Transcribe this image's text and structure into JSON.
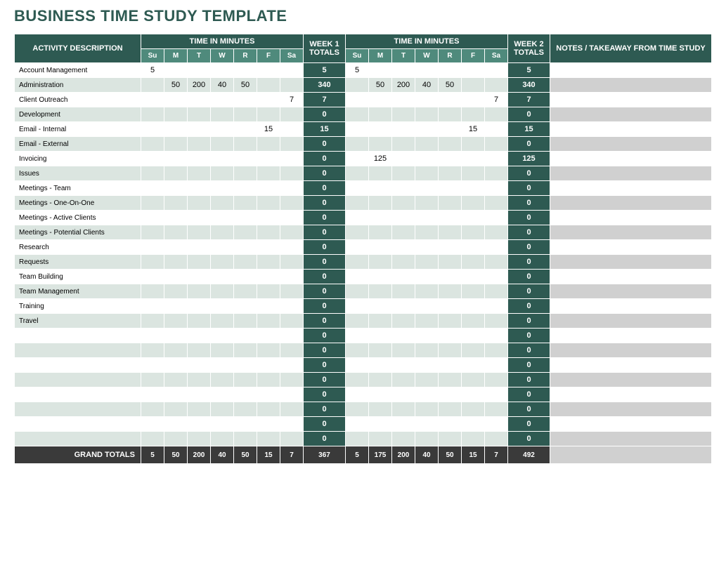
{
  "title": "BUSINESS TIME STUDY TEMPLATE",
  "headers": {
    "activity": "ACTIVITY DESCRIPTION",
    "time_in_minutes": "TIME IN MINUTES",
    "week1_totals": "WEEK 1 TOTALS",
    "week2_totals": "WEEK 2 TOTALS",
    "notes": "NOTES / TAKEAWAY FROM TIME STUDY",
    "days": [
      "Su",
      "M",
      "T",
      "W",
      "R",
      "F",
      "Sa"
    ]
  },
  "rows": [
    {
      "activity": "Account Management",
      "w1": [
        "5",
        "",
        "",
        "",
        "",
        "",
        ""
      ],
      "t1": "5",
      "w2": [
        "5",
        "",
        "",
        "",
        "",
        "",
        ""
      ],
      "t2": "5",
      "notes": ""
    },
    {
      "activity": "Administration",
      "w1": [
        "",
        "50",
        "200",
        "40",
        "50",
        "",
        ""
      ],
      "t1": "340",
      "w2": [
        "",
        "50",
        "200",
        "40",
        "50",
        "",
        ""
      ],
      "t2": "340",
      "notes": ""
    },
    {
      "activity": "Client Outreach",
      "w1": [
        "",
        "",
        "",
        "",
        "",
        "",
        "7"
      ],
      "t1": "7",
      "w2": [
        "",
        "",
        "",
        "",
        "",
        "",
        "7"
      ],
      "t2": "7",
      "notes": ""
    },
    {
      "activity": "Development",
      "w1": [
        "",
        "",
        "",
        "",
        "",
        "",
        ""
      ],
      "t1": "0",
      "w2": [
        "",
        "",
        "",
        "",
        "",
        "",
        ""
      ],
      "t2": "0",
      "notes": ""
    },
    {
      "activity": "Email - Internal",
      "w1": [
        "",
        "",
        "",
        "",
        "",
        "15",
        ""
      ],
      "t1": "15",
      "w2": [
        "",
        "",
        "",
        "",
        "",
        "15",
        ""
      ],
      "t2": "15",
      "notes": ""
    },
    {
      "activity": "Email - External",
      "w1": [
        "",
        "",
        "",
        "",
        "",
        "",
        ""
      ],
      "t1": "0",
      "w2": [
        "",
        "",
        "",
        "",
        "",
        "",
        ""
      ],
      "t2": "0",
      "notes": ""
    },
    {
      "activity": "Invoicing",
      "w1": [
        "",
        "",
        "",
        "",
        "",
        "",
        ""
      ],
      "t1": "0",
      "w2": [
        "",
        "125",
        "",
        "",
        "",
        "",
        ""
      ],
      "t2": "125",
      "notes": ""
    },
    {
      "activity": "Issues",
      "w1": [
        "",
        "",
        "",
        "",
        "",
        "",
        ""
      ],
      "t1": "0",
      "w2": [
        "",
        "",
        "",
        "",
        "",
        "",
        ""
      ],
      "t2": "0",
      "notes": ""
    },
    {
      "activity": "Meetings - Team",
      "w1": [
        "",
        "",
        "",
        "",
        "",
        "",
        ""
      ],
      "t1": "0",
      "w2": [
        "",
        "",
        "",
        "",
        "",
        "",
        ""
      ],
      "t2": "0",
      "notes": ""
    },
    {
      "activity": "Meetings - One-On-One",
      "w1": [
        "",
        "",
        "",
        "",
        "",
        "",
        ""
      ],
      "t1": "0",
      "w2": [
        "",
        "",
        "",
        "",
        "",
        "",
        ""
      ],
      "t2": "0",
      "notes": ""
    },
    {
      "activity": "Meetings - Active Clients",
      "w1": [
        "",
        "",
        "",
        "",
        "",
        "",
        ""
      ],
      "t1": "0",
      "w2": [
        "",
        "",
        "",
        "",
        "",
        "",
        ""
      ],
      "t2": "0",
      "notes": ""
    },
    {
      "activity": "Meetings - Potential Clients",
      "w1": [
        "",
        "",
        "",
        "",
        "",
        "",
        ""
      ],
      "t1": "0",
      "w2": [
        "",
        "",
        "",
        "",
        "",
        "",
        ""
      ],
      "t2": "0",
      "notes": ""
    },
    {
      "activity": "Research",
      "w1": [
        "",
        "",
        "",
        "",
        "",
        "",
        ""
      ],
      "t1": "0",
      "w2": [
        "",
        "",
        "",
        "",
        "",
        "",
        ""
      ],
      "t2": "0",
      "notes": ""
    },
    {
      "activity": "Requests",
      "w1": [
        "",
        "",
        "",
        "",
        "",
        "",
        ""
      ],
      "t1": "0",
      "w2": [
        "",
        "",
        "",
        "",
        "",
        "",
        ""
      ],
      "t2": "0",
      "notes": ""
    },
    {
      "activity": "Team Building",
      "w1": [
        "",
        "",
        "",
        "",
        "",
        "",
        ""
      ],
      "t1": "0",
      "w2": [
        "",
        "",
        "",
        "",
        "",
        "",
        ""
      ],
      "t2": "0",
      "notes": ""
    },
    {
      "activity": "Team Management",
      "w1": [
        "",
        "",
        "",
        "",
        "",
        "",
        ""
      ],
      "t1": "0",
      "w2": [
        "",
        "",
        "",
        "",
        "",
        "",
        ""
      ],
      "t2": "0",
      "notes": ""
    },
    {
      "activity": "Training",
      "w1": [
        "",
        "",
        "",
        "",
        "",
        "",
        ""
      ],
      "t1": "0",
      "w2": [
        "",
        "",
        "",
        "",
        "",
        "",
        ""
      ],
      "t2": "0",
      "notes": ""
    },
    {
      "activity": "Travel",
      "w1": [
        "",
        "",
        "",
        "",
        "",
        "",
        ""
      ],
      "t1": "0",
      "w2": [
        "",
        "",
        "",
        "",
        "",
        "",
        ""
      ],
      "t2": "0",
      "notes": ""
    },
    {
      "activity": "",
      "w1": [
        "",
        "",
        "",
        "",
        "",
        "",
        ""
      ],
      "t1": "0",
      "w2": [
        "",
        "",
        "",
        "",
        "",
        "",
        ""
      ],
      "t2": "0",
      "notes": ""
    },
    {
      "activity": "",
      "w1": [
        "",
        "",
        "",
        "",
        "",
        "",
        ""
      ],
      "t1": "0",
      "w2": [
        "",
        "",
        "",
        "",
        "",
        "",
        ""
      ],
      "t2": "0",
      "notes": ""
    },
    {
      "activity": "",
      "w1": [
        "",
        "",
        "",
        "",
        "",
        "",
        ""
      ],
      "t1": "0",
      "w2": [
        "",
        "",
        "",
        "",
        "",
        "",
        ""
      ],
      "t2": "0",
      "notes": ""
    },
    {
      "activity": "",
      "w1": [
        "",
        "",
        "",
        "",
        "",
        "",
        ""
      ],
      "t1": "0",
      "w2": [
        "",
        "",
        "",
        "",
        "",
        "",
        ""
      ],
      "t2": "0",
      "notes": ""
    },
    {
      "activity": "",
      "w1": [
        "",
        "",
        "",
        "",
        "",
        "",
        ""
      ],
      "t1": "0",
      "w2": [
        "",
        "",
        "",
        "",
        "",
        "",
        ""
      ],
      "t2": "0",
      "notes": ""
    },
    {
      "activity": "",
      "w1": [
        "",
        "",
        "",
        "",
        "",
        "",
        ""
      ],
      "t1": "0",
      "w2": [
        "",
        "",
        "",
        "",
        "",
        "",
        ""
      ],
      "t2": "0",
      "notes": ""
    },
    {
      "activity": "",
      "w1": [
        "",
        "",
        "",
        "",
        "",
        "",
        ""
      ],
      "t1": "0",
      "w2": [
        "",
        "",
        "",
        "",
        "",
        "",
        ""
      ],
      "t2": "0",
      "notes": ""
    },
    {
      "activity": "",
      "w1": [
        "",
        "",
        "",
        "",
        "",
        "",
        ""
      ],
      "t1": "0",
      "w2": [
        "",
        "",
        "",
        "",
        "",
        "",
        ""
      ],
      "t2": "0",
      "notes": ""
    }
  ],
  "grand": {
    "label": "GRAND TOTALS",
    "w1": [
      "5",
      "50",
      "200",
      "40",
      "50",
      "15",
      "7"
    ],
    "t1": "367",
    "w2": [
      "5",
      "175",
      "200",
      "40",
      "50",
      "15",
      "7"
    ],
    "t2": "492"
  }
}
